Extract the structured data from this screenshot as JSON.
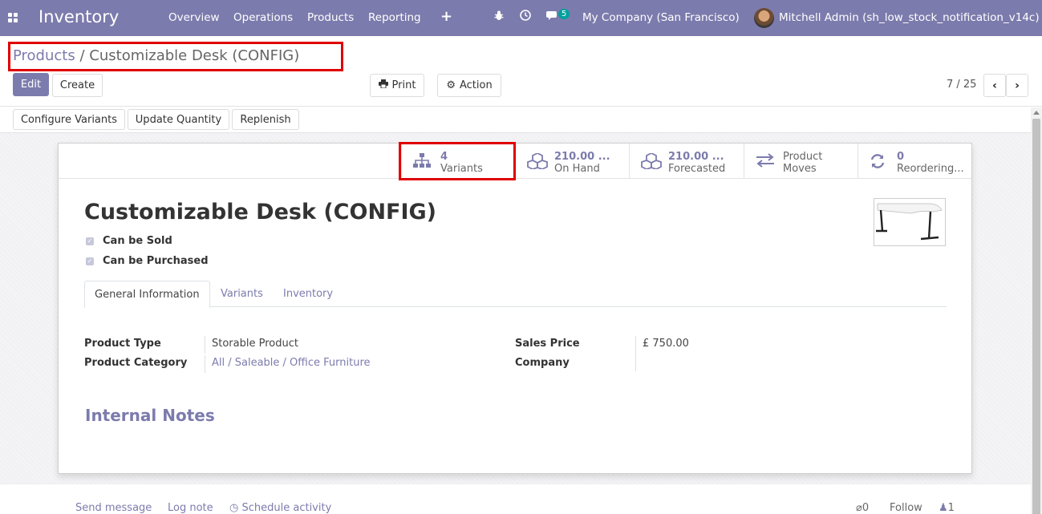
{
  "navbar": {
    "app_name": "Inventory",
    "menus": [
      "Overview",
      "Operations",
      "Products",
      "Reporting"
    ],
    "plus_icon": "plus-icon",
    "bug_icon": "bug-icon",
    "clock_icon": "clock-icon",
    "chat_icon": "chat-icon",
    "message_count": "5",
    "company": "My Company (San Francisco)",
    "user": "Mitchell Admin (sh_low_stock_notification_v14c)"
  },
  "breadcrumb": {
    "parent": "Products",
    "separator": "/",
    "current": "Customizable Desk (CONFIG)"
  },
  "control": {
    "edit": "Edit",
    "create": "Create",
    "print": "Print",
    "action": "Action",
    "pager": "7 / 25"
  },
  "header_buttons": [
    "Configure Variants",
    "Update Quantity",
    "Replenish"
  ],
  "smart_buttons": [
    {
      "value": "4",
      "label": "Variants",
      "icon": "sitemap-icon"
    },
    {
      "value": "210.00 ...",
      "label": "On Hand",
      "icon": "cubes-icon"
    },
    {
      "value": "210.00 ...",
      "label": "Forecasted",
      "icon": "cubes-icon"
    },
    {
      "value": "Product",
      "label": "Moves",
      "icon": "exchange-icon"
    },
    {
      "value": "0",
      "label": "Reordering...",
      "icon": "refresh-icon"
    }
  ],
  "product": {
    "name": "Customizable Desk (CONFIG)",
    "can_be_sold": "Can be Sold",
    "can_be_purchased": "Can be Purchased"
  },
  "tabs": [
    "General Information",
    "Variants",
    "Inventory"
  ],
  "fields": {
    "product_type_label": "Product Type",
    "product_type_value": "Storable Product",
    "product_category_label": "Product Category",
    "product_category_value": "All / Saleable / Office Furniture",
    "sales_price_label": "Sales Price",
    "sales_price_value": "£ 750.00",
    "company_label": "Company",
    "company_value": ""
  },
  "internal_notes_title": "Internal Notes",
  "chatter": {
    "send_message": "Send message",
    "log_note": "Log note",
    "schedule_activity": "Schedule activity",
    "attachments": "0",
    "follow": "Follow",
    "followers": "1"
  },
  "colors": {
    "brand": "#7c7bad",
    "highlight": "#e00000",
    "badge": "#00a09d"
  }
}
